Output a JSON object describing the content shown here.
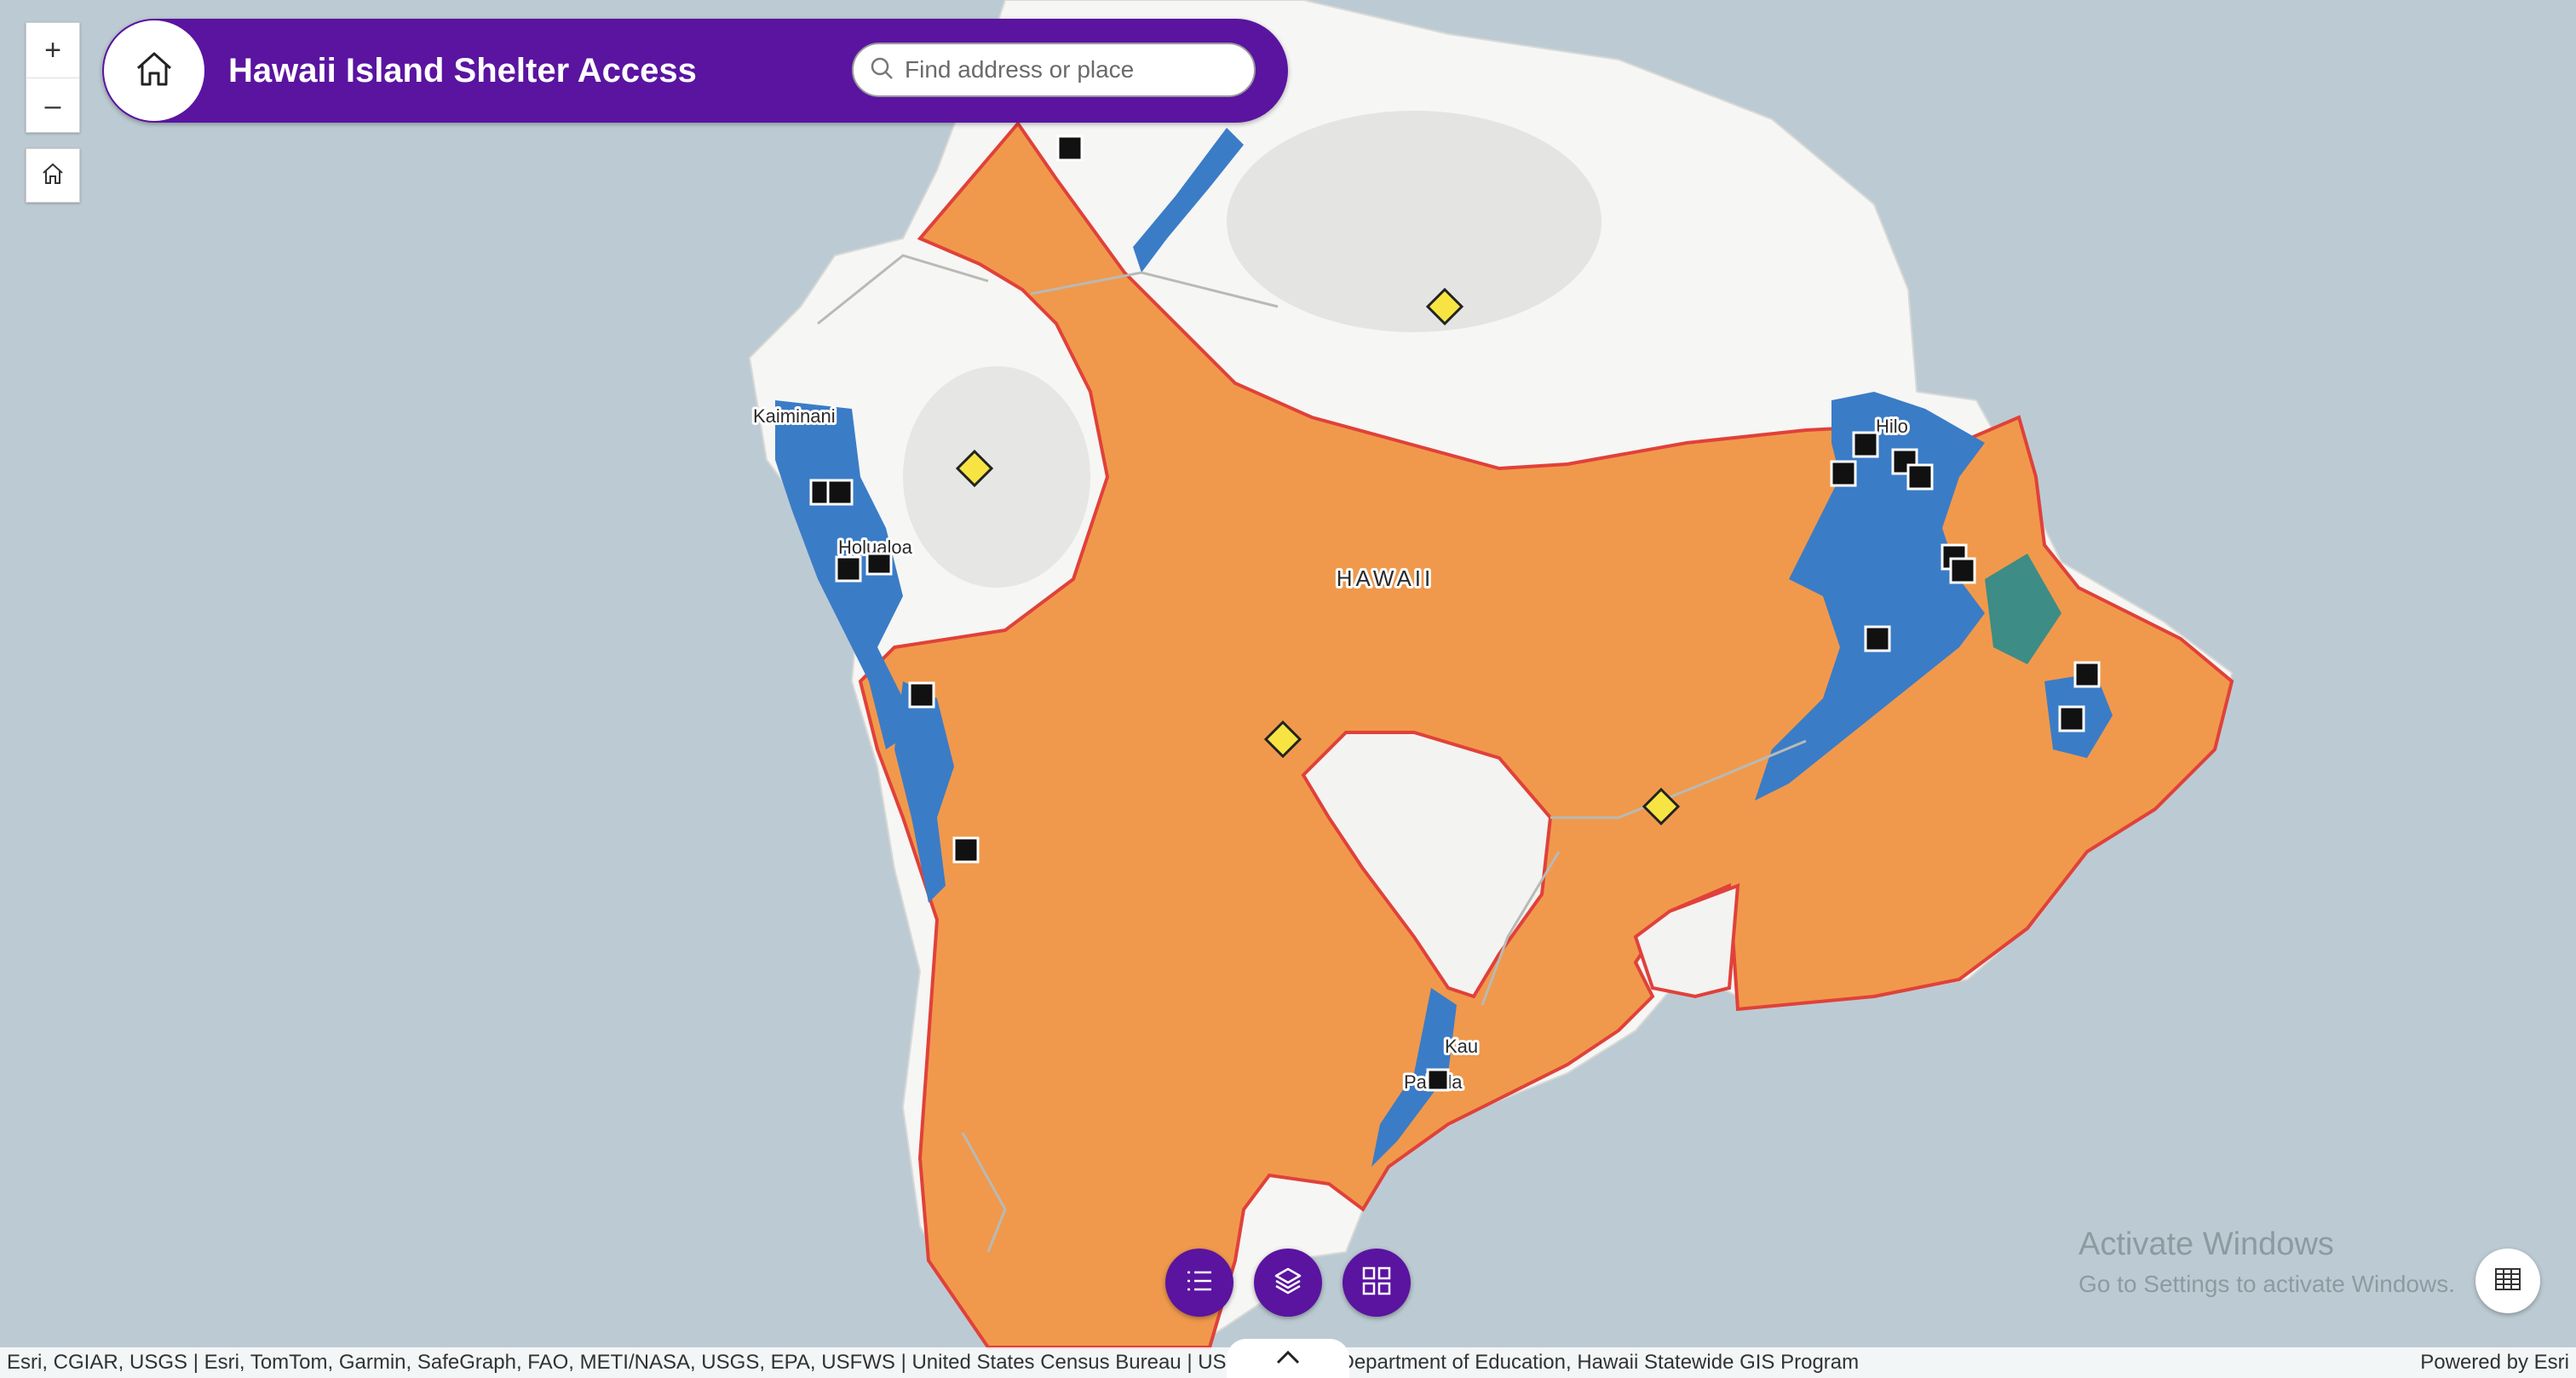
{
  "header": {
    "title": "Hawaii Island Shelter Access"
  },
  "search": {
    "placeholder": "Find address or place"
  },
  "zoom": {
    "in_label": "+",
    "out_label": "–"
  },
  "map_labels": {
    "island": "HAWAII",
    "kaiminani": "Kaiminani",
    "holualoa": "Holualoa",
    "hilo": "Hilo",
    "kau": "Kau",
    "pahala": "Pahala"
  },
  "watermark": {
    "line1": "Activate Windows",
    "line2": "Go to Settings to activate Windows."
  },
  "attribution": {
    "text": "Esri, CGIAR, USGS | Esri, TomTom, Garmin, SafeGraph, FAO, METI/NASA, USGS, EPA, USFWS | United States Census Bureau | USGS | Hawaii Department of Education, Hawaii Statewide GIS Program",
    "powered": "Powered by Esri"
  },
  "icons": {
    "home": "home-icon",
    "search": "search-icon",
    "list": "list-icon",
    "layers": "layers-icon",
    "grid": "grid-icon",
    "table": "table-icon",
    "chevron": "chevron-up-icon"
  },
  "colors": {
    "header": "#5a14a0",
    "coverage_zone": "#f0994c",
    "zone_outline": "#e0413a",
    "water_access": "#3b7cc7",
    "ocean": "#bccbd3",
    "diamond_marker": "#f7e442",
    "square_marker": "#111111"
  }
}
